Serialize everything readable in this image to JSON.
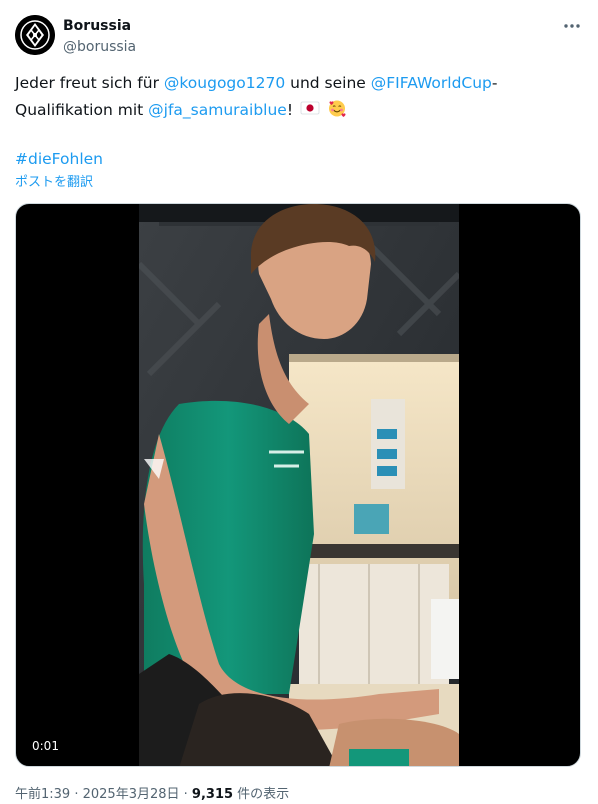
{
  "author": {
    "name": "Borussia",
    "handle": "@borussia"
  },
  "tweet": {
    "line1_prefix": "Jeder freut sich für ",
    "mention1": "@kougogo1270",
    "line1_middle": " und seine ",
    "mention2": "@FIFAWorldCup",
    "line1_suffix": "-",
    "line2_prefix": "Qualifikation mit ",
    "mention3": "@jfa_samuraiblue",
    "line2_suffix": "!",
    "emojis": [
      "japan-flag",
      "smiling-face-with-hearts"
    ],
    "hashtag": "#dieFohlen"
  },
  "translate_label": "ポストを翻訳",
  "video": {
    "timestamp": "0:01"
  },
  "meta": {
    "time": "午前1:39",
    "separator1": " · ",
    "date": "2025年3月28日",
    "separator2": " · ",
    "views": "9,315",
    "views_suffix": " 件の表示"
  },
  "colors": {
    "link": "#1d9bf0",
    "text": "#0f1419",
    "secondary": "#536471",
    "shirt": "#129070"
  }
}
